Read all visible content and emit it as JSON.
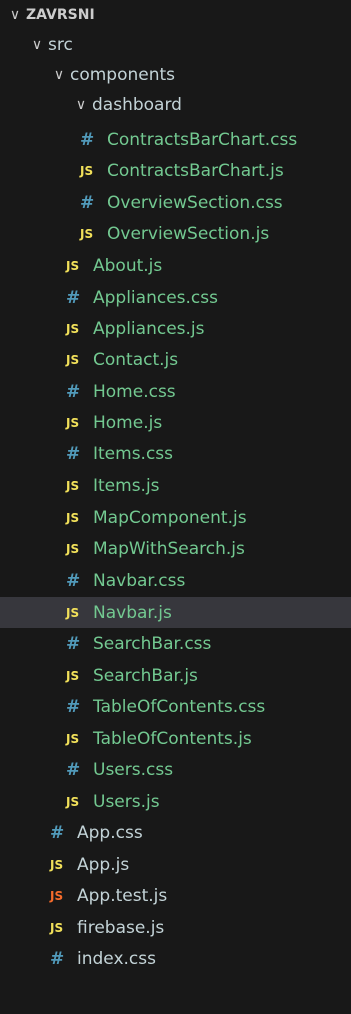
{
  "root": {
    "label": "ZAVRSNI"
  },
  "folders": {
    "src": "src",
    "components": "components",
    "dashboard": "dashboard"
  },
  "colors": {
    "background": "#181818",
    "selected_row": "#37373d",
    "file_text": "#73c991",
    "js_icon": "#f1e05a",
    "js_icon_test": "#f56b2b",
    "css_icon": "#519aba",
    "chevron": "#cccccc"
  },
  "icons": {
    "js": "JS",
    "css": "#",
    "chevron_open": "∨"
  },
  "files": [
    {
      "name": "ContractsBarChart.css",
      "type": "css"
    },
    {
      "name": "ContractsBarChart.js",
      "type": "js"
    },
    {
      "name": "OverviewSection.css",
      "type": "css"
    },
    {
      "name": "OverviewSection.js",
      "type": "js"
    },
    {
      "name": "About.js",
      "type": "js"
    },
    {
      "name": "Appliances.css",
      "type": "css"
    },
    {
      "name": "Appliances.js",
      "type": "js"
    },
    {
      "name": "Contact.js",
      "type": "js"
    },
    {
      "name": "Home.css",
      "type": "css"
    },
    {
      "name": "Home.js",
      "type": "js"
    },
    {
      "name": "Items.css",
      "type": "css"
    },
    {
      "name": "Items.js",
      "type": "js"
    },
    {
      "name": "MapComponent.js",
      "type": "js"
    },
    {
      "name": "MapWithSearch.js",
      "type": "js"
    },
    {
      "name": "Navbar.css",
      "type": "css"
    },
    {
      "name": "Navbar.js",
      "type": "js",
      "selected": true
    },
    {
      "name": "SearchBar.css",
      "type": "css"
    },
    {
      "name": "SearchBar.js",
      "type": "js"
    },
    {
      "name": "TableOfContents.css",
      "type": "css"
    },
    {
      "name": "TableOfContents.js",
      "type": "js"
    },
    {
      "name": "Users.css",
      "type": "css"
    },
    {
      "name": "Users.js",
      "type": "js"
    },
    {
      "name": "App.css",
      "type": "css"
    },
    {
      "name": "App.js",
      "type": "js"
    },
    {
      "name": "App.test.js",
      "type": "js-test"
    },
    {
      "name": "firebase.js",
      "type": "js"
    },
    {
      "name": "index.css",
      "type": "css"
    }
  ]
}
